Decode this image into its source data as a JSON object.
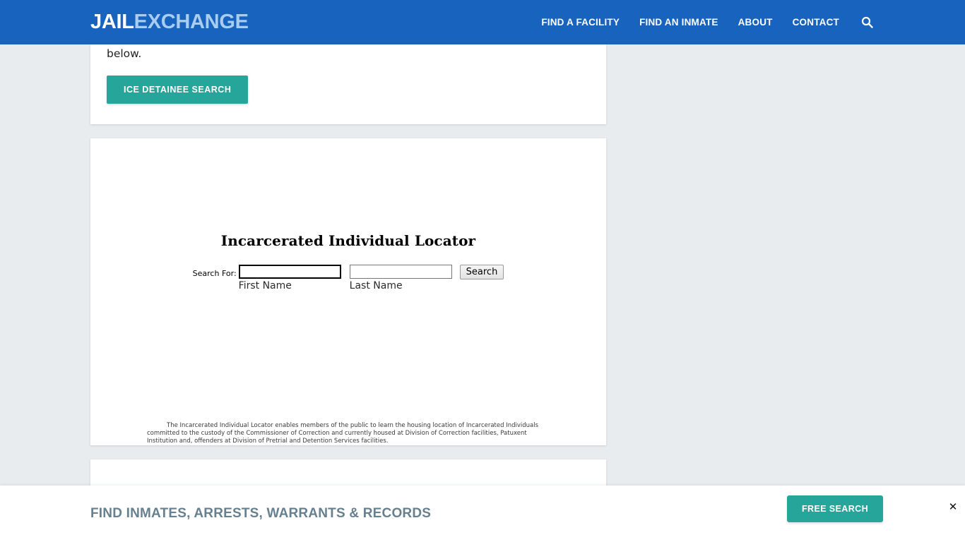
{
  "header": {
    "logo_primary": "JAIL",
    "logo_secondary": "EXCHANGE",
    "nav": [
      {
        "label": "FIND A FACILITY"
      },
      {
        "label": "FIND AN INMATE"
      },
      {
        "label": "ABOUT"
      },
      {
        "label": "CONTACT"
      }
    ],
    "search_icon": "search-icon",
    "background_color": "#1763bd"
  },
  "cards": {
    "ice": {
      "paragraph_tail": "below.",
      "button_label": "ICE DETAINEE SEARCH",
      "button_color": "#26a69a"
    },
    "locator": {
      "title": "Incarcerated Individual Locator",
      "search_for_label": "Search For:",
      "first_name_value": "",
      "first_name_placeholder": "",
      "first_name_caption": "First Name",
      "last_name_value": "",
      "last_name_placeholder": "",
      "last_name_caption": "Last Name",
      "submit_label": "Search",
      "description": "The Incarcerated Individual Locator enables members of the public to learn the housing location of Incarcerated Individuals committed to the custody of the Commissioner of Correction and currently housed at Division of Correction facilities, Patuxent Institution and, offenders at Division of Pretrial and Detention Services facilities."
    }
  },
  "bottom_bar": {
    "title": "FIND INMATES, ARRESTS, WARRANTS & RECORDS",
    "cta_label": "FREE SEARCH",
    "cta_color": "#26a69a",
    "close_icon": "close-icon",
    "close_glyph": "✕"
  },
  "page": {
    "background_color": "#e9ecef"
  }
}
